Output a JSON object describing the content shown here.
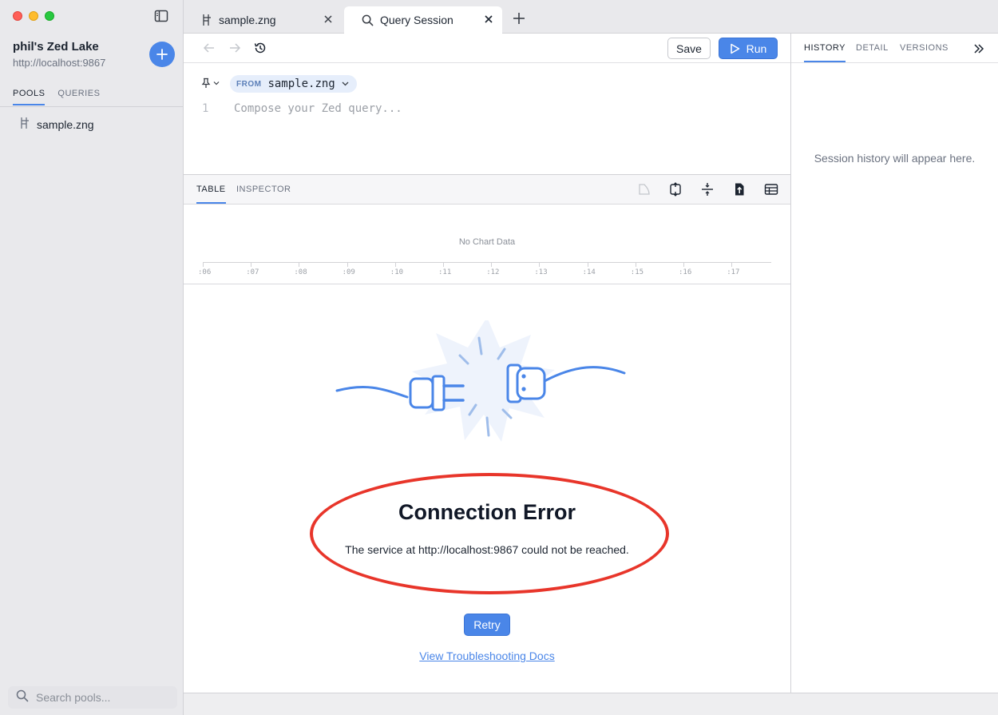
{
  "sidebar": {
    "lake_name": "phil's Zed Lake",
    "lake_url": "http://localhost:9867",
    "tabs": [
      {
        "label": "POOLS",
        "active": true
      },
      {
        "label": "QUERIES",
        "active": false
      }
    ],
    "pools": [
      {
        "name": "sample.zng",
        "icon": "pool-icon"
      }
    ],
    "search": {
      "placeholder": "Search pools..."
    }
  },
  "tabs": [
    {
      "label": "sample.zng",
      "icon": "pool-icon",
      "active": false
    },
    {
      "label": "Query Session",
      "icon": "search-icon",
      "active": true
    }
  ],
  "toolbar": {
    "save_label": "Save",
    "run_label": "Run"
  },
  "editor": {
    "from_label": "FROM",
    "from_pool": "sample.zng",
    "line_number": "1",
    "placeholder": "Compose your Zed query..."
  },
  "results": {
    "tabs": [
      {
        "label": "TABLE",
        "active": true
      },
      {
        "label": "INSPECTOR",
        "active": false
      }
    ],
    "chart": {
      "empty_label": "No Chart Data",
      "ticks": [
        ":06",
        ":07",
        ":08",
        ":09",
        ":10",
        ":11",
        ":12",
        ":13",
        ":14",
        ":15",
        ":16",
        ":17"
      ]
    }
  },
  "error": {
    "title": "Connection Error",
    "message": "The service at http://localhost:9867 could not be reached.",
    "retry_label": "Retry",
    "docs_link": "View Troubleshooting Docs"
  },
  "right_pane": {
    "tabs": [
      {
        "label": "HISTORY",
        "active": true
      },
      {
        "label": "DETAIL",
        "active": false
      },
      {
        "label": "VERSIONS",
        "active": false
      }
    ],
    "empty_message": "Session history will appear here."
  },
  "colors": {
    "accent": "#4a86e8",
    "highlight_ring": "#e8352a",
    "sidebar_bg": "#e9e9ec"
  }
}
